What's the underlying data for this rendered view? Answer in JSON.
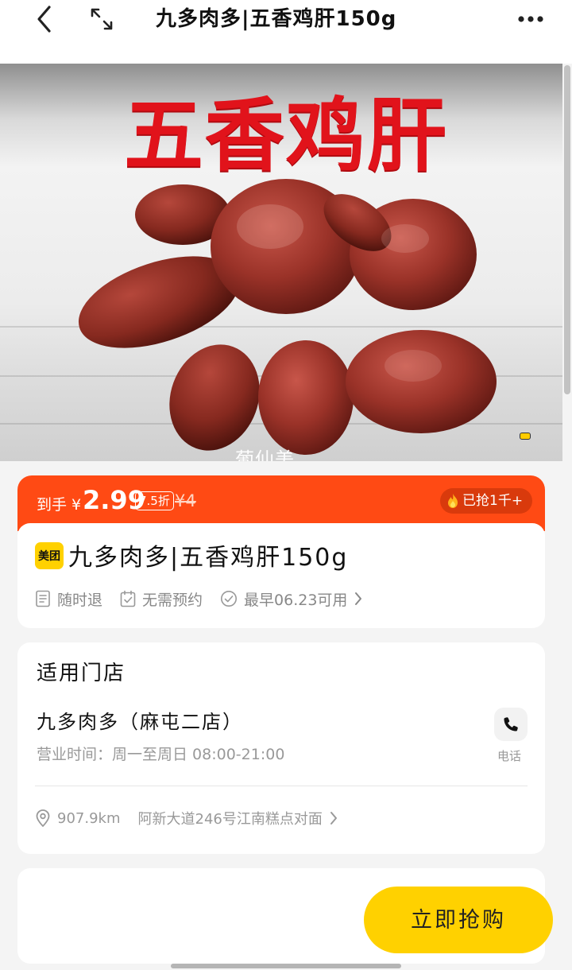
{
  "header": {
    "title": "九多肉多|五香鸡肝150g"
  },
  "hero": {
    "headline": "五香鸡肝",
    "watermark": "葡仙美"
  },
  "price": {
    "label": "到手 ¥",
    "amount": "2.99",
    "discount": "7.5折",
    "original": "¥4",
    "sold": "已抢1千+"
  },
  "product": {
    "badge": "美团",
    "name": "九多肉多|五香鸡肝150g",
    "features": [
      "随时退",
      "无需预约",
      "最早06.23可用"
    ]
  },
  "store": {
    "section_title": "适用门店",
    "name": "九多肉多（麻屯二店）",
    "hours": "营业时间：周一至周日 08:00-21:00",
    "phone_label": "电话",
    "distance": "907.9km",
    "address": "阿新大道246号江南糕点对面"
  },
  "action": {
    "buy_label": "立即抢购"
  },
  "colors": {
    "accent_orange": "#ff4a14",
    "brand_yellow": "#ffd100",
    "headline_red": "#e1131b"
  }
}
